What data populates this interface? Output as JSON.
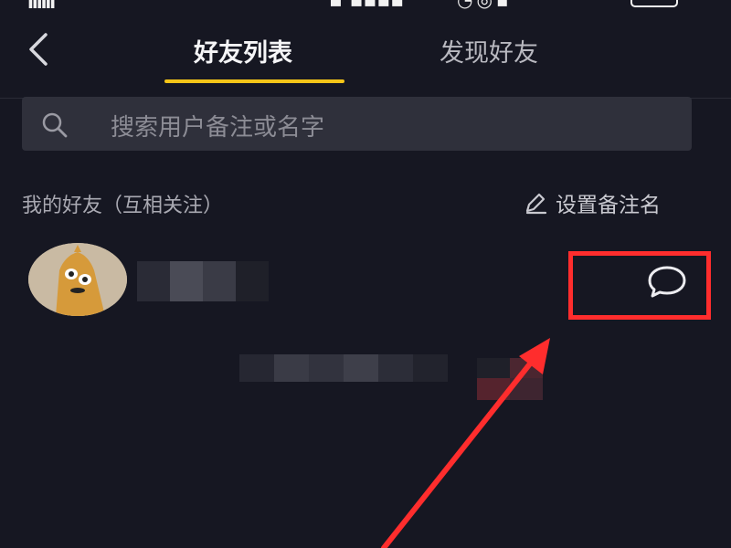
{
  "header": {
    "tabs": [
      {
        "label": "好友列表",
        "active": true
      },
      {
        "label": "发现好友",
        "active": false
      }
    ]
  },
  "search": {
    "placeholder": "搜索用户备注或名字"
  },
  "section": {
    "title": "我的好友（互相关注）",
    "action_label": "设置备注名"
  },
  "friends": [
    {
      "name_blurred": true
    }
  ],
  "colors": {
    "background": "#161722",
    "accent": "#f5c518",
    "annotation": "#ff2d2d",
    "search_bg": "#2f303b"
  },
  "icons": [
    "back-arrow-icon",
    "search-icon",
    "pencil-icon",
    "chat-bubble-icon"
  ]
}
